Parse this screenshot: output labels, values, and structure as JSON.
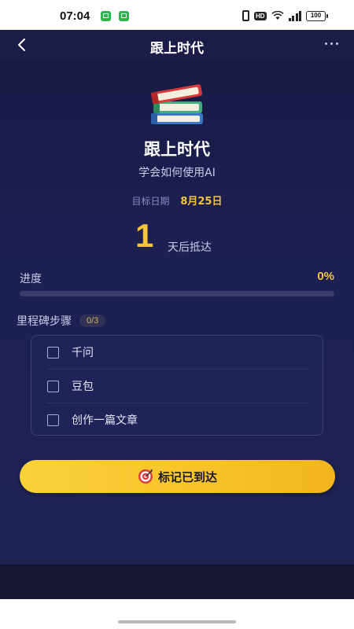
{
  "status_bar": {
    "time": "07:04",
    "hd_badge": "HD",
    "battery": "100"
  },
  "header": {
    "title": "跟上时代"
  },
  "goal": {
    "icon": "books-icon",
    "title": "跟上时代",
    "subtitle": "学会如何使用AI",
    "date_label": "目标日期",
    "date_value": "8月25日",
    "countdown_value": "1",
    "countdown_label": "天后抵达"
  },
  "progress": {
    "label": "进度",
    "percent_text": "0%",
    "fraction": 0
  },
  "milestones": {
    "title": "里程碑步骤",
    "count": "0/3",
    "items": [
      {
        "label": "千问",
        "checked": false
      },
      {
        "label": "豆包",
        "checked": false
      },
      {
        "label": "创作一篇文章",
        "checked": false
      }
    ]
  },
  "action": {
    "icon": "target-icon",
    "label": "标记已到达"
  },
  "colors": {
    "accent_yellow": "#f7c637",
    "background": "#1b1d48",
    "card_border": "#3c417a"
  }
}
